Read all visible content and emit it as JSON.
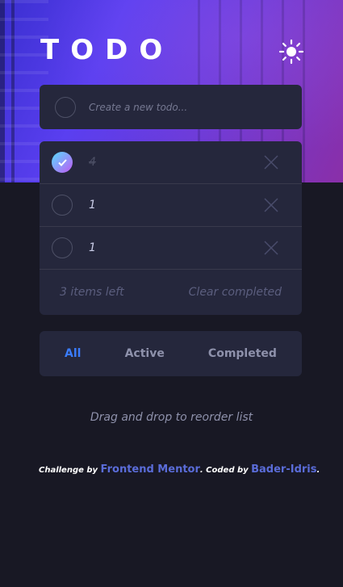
{
  "header": {
    "title": "TODO",
    "theme_icon": "sun-icon"
  },
  "new_todo": {
    "placeholder": "Create a new todo...",
    "value": ""
  },
  "todos": [
    {
      "text": "4",
      "completed": true
    },
    {
      "text": "1",
      "completed": false
    },
    {
      "text": "1",
      "completed": false
    }
  ],
  "list_footer": {
    "items_left": "3 items left",
    "clear_label": "Clear completed"
  },
  "filters": {
    "all": "All",
    "active": "Active",
    "completed": "Completed",
    "selected": "All"
  },
  "hint": "Drag and drop to reorder list",
  "attribution": {
    "prefix": "Challenge by",
    "link1": "Frontend Mentor",
    "middle": ". Coded by",
    "link2": "Bader-Idris",
    "suffix": "."
  },
  "colors": {
    "background": "#181824",
    "card": "#25273c",
    "accent": "#3a7cfd",
    "check_gradient_start": "#57ddff",
    "check_gradient_end": "#c058f3"
  }
}
